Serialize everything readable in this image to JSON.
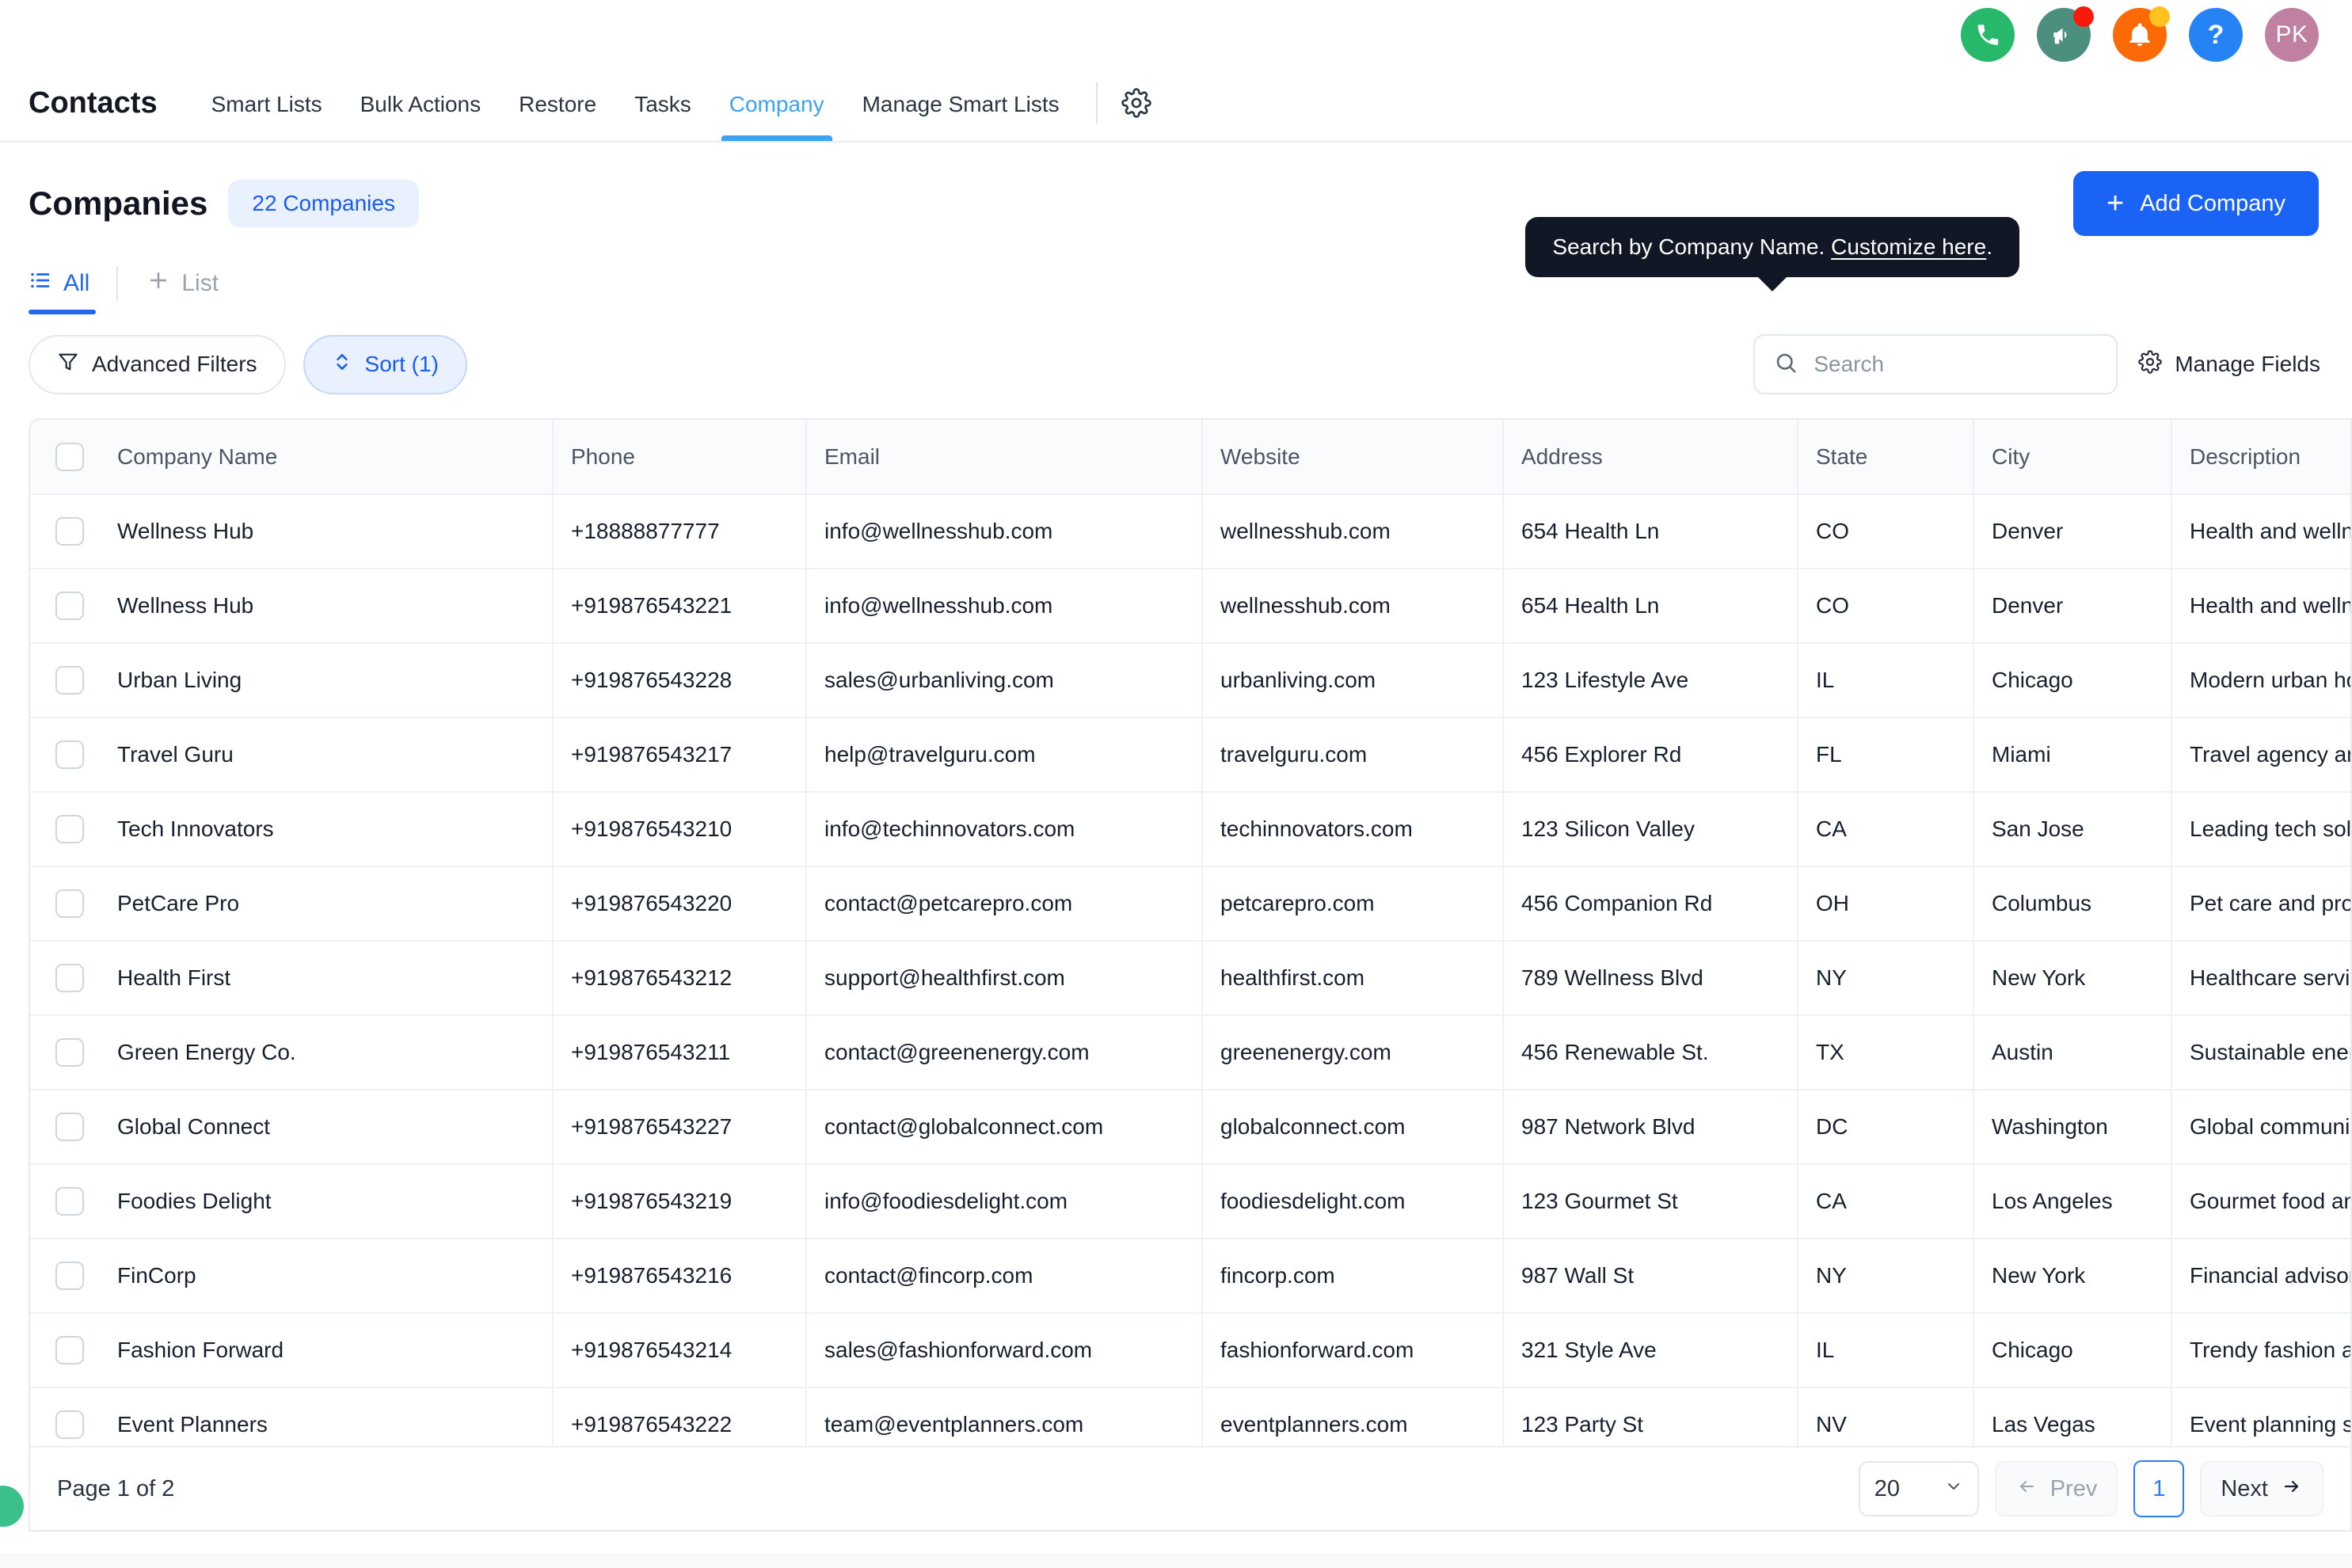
{
  "topbar": {
    "icons": [
      {
        "name": "phone-icon",
        "color": "#27b86a",
        "badge": null
      },
      {
        "name": "megaphone-icon",
        "color": "#4d8f7f",
        "badge": "#f81b0c"
      },
      {
        "name": "bell-icon",
        "color": "#fb6a07",
        "badge": "#ffc21f"
      },
      {
        "name": "help-icon",
        "color": "#2583f6",
        "label": "?"
      },
      {
        "name": "avatar",
        "color": "#bf80a2",
        "label": "PK"
      }
    ]
  },
  "nav": {
    "title": "Contacts",
    "items": [
      {
        "label": "Smart Lists",
        "active": false
      },
      {
        "label": "Bulk Actions",
        "active": false
      },
      {
        "label": "Restore",
        "active": false
      },
      {
        "label": "Tasks",
        "active": false
      },
      {
        "label": "Company",
        "active": true
      },
      {
        "label": "Manage Smart Lists",
        "active": false
      }
    ],
    "settings_icon": "gear-icon"
  },
  "page": {
    "title": "Companies",
    "count_badge": "22 Companies",
    "add_button": "Add Company",
    "accent_color": "#1a63f5"
  },
  "view_tabs": [
    {
      "label": "All",
      "icon": "list-icon",
      "active": true
    },
    {
      "label": "List",
      "icon": "plus-icon",
      "active": false
    }
  ],
  "filters": {
    "advanced_label": "Advanced Filters",
    "advanced_icon": "filter-icon",
    "sort_label": "Sort (1)",
    "sort_icon": "sort-icon",
    "manage_fields_label": "Manage Fields",
    "manage_fields_icon": "gear-icon"
  },
  "search": {
    "placeholder": "Search",
    "value": "",
    "icon": "search-icon"
  },
  "tooltip": {
    "text_before": "Search by Company Name. ",
    "link": "Customize here",
    "text_after": "."
  },
  "table": {
    "columns": [
      "Company Name",
      "Phone",
      "Email",
      "Website",
      "Address",
      "State",
      "City",
      "Description"
    ],
    "rows": [
      {
        "company_name": "Wellness Hub",
        "phone": "+18888877777",
        "email": "info@wellnesshub.com",
        "website": "wellnesshub.com",
        "address": "654 Health Ln",
        "state": "CO",
        "city": "Denver",
        "description": "Health and wellness"
      },
      {
        "company_name": "Wellness Hub",
        "phone": "+919876543221",
        "email": "info@wellnesshub.com",
        "website": "wellnesshub.com",
        "address": "654 Health Ln",
        "state": "CO",
        "city": "Denver",
        "description": "Health and wellness"
      },
      {
        "company_name": "Urban Living",
        "phone": "+919876543228",
        "email": "sales@urbanliving.com",
        "website": "urbanliving.com",
        "address": "123 Lifestyle Ave",
        "state": "IL",
        "city": "Chicago",
        "description": "Modern urban housing"
      },
      {
        "company_name": "Travel Guru",
        "phone": "+919876543217",
        "email": "help@travelguru.com",
        "website": "travelguru.com",
        "address": "456 Explorer Rd",
        "state": "FL",
        "city": "Miami",
        "description": "Travel agency and bo"
      },
      {
        "company_name": "Tech Innovators",
        "phone": "+919876543210",
        "email": "info@techinnovators.com",
        "website": "techinnovators.com",
        "address": "123 Silicon Valley",
        "state": "CA",
        "city": "San Jose",
        "description": "Leading tech solution"
      },
      {
        "company_name": "PetCare Pro",
        "phone": "+919876543220",
        "email": "contact@petcarepro.com",
        "website": "petcarepro.com",
        "address": "456 Companion Rd",
        "state": "OH",
        "city": "Columbus",
        "description": "Pet care and product"
      },
      {
        "company_name": "Health First",
        "phone": "+919876543212",
        "email": "support@healthfirst.com",
        "website": "healthfirst.com",
        "address": "789 Wellness Blvd",
        "state": "NY",
        "city": "New York",
        "description": "Healthcare services"
      },
      {
        "company_name": "Green Energy Co.",
        "phone": "+919876543211",
        "email": "contact@greenenergy.com",
        "website": "greenenergy.com",
        "address": "456 Renewable St.",
        "state": "TX",
        "city": "Austin",
        "description": "Sustainable energy s"
      },
      {
        "company_name": "Global Connect",
        "phone": "+919876543227",
        "email": "contact@globalconnect.com",
        "website": "globalconnect.com",
        "address": "987 Network Blvd",
        "state": "DC",
        "city": "Washington",
        "description": "Global communicatio"
      },
      {
        "company_name": "Foodies Delight",
        "phone": "+919876543219",
        "email": "info@foodiesdelight.com",
        "website": "foodiesdelight.com",
        "address": "123 Gourmet St",
        "state": "CA",
        "city": "Los Angeles",
        "description": "Gourmet food and se"
      },
      {
        "company_name": "FinCorp",
        "phone": "+919876543216",
        "email": "contact@fincorp.com",
        "website": "fincorp.com",
        "address": "987 Wall St",
        "state": "NY",
        "city": "New York",
        "description": "Financial advisory se"
      },
      {
        "company_name": "Fashion Forward",
        "phone": "+919876543214",
        "email": "sales@fashionforward.com",
        "website": "fashionforward.com",
        "address": "321 Style Ave",
        "state": "IL",
        "city": "Chicago",
        "description": "Trendy fashion appa"
      },
      {
        "company_name": "Event Planners",
        "phone": "+919876543222",
        "email": "team@eventplanners.com",
        "website": "eventplanners.com",
        "address": "123 Party St",
        "state": "NV",
        "city": "Las Vegas",
        "description": "Event planning servic"
      }
    ]
  },
  "pagination": {
    "page_of": "Page 1 of 2",
    "per_page": "20",
    "prev_label": "Prev",
    "next_label": "Next",
    "current_page": "1"
  }
}
